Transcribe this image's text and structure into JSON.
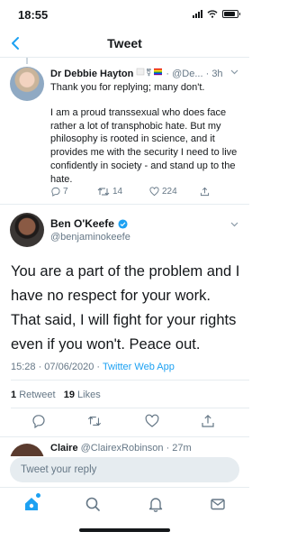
{
  "status": {
    "time": "18:55"
  },
  "nav": {
    "title": "Tweet"
  },
  "reply": {
    "name": "Dr Debbie Hayton",
    "handle_meta": "· @De... · 3h",
    "body": [
      "Thank you for replying; many don't.",
      "I am a proud transsexual who does face rather a lot of transphobic hate. But my philosophy is rooted in science, and it provides me with the security I need to live confidently in society - and stand up to the hate."
    ],
    "replies": "7",
    "retweets": "14",
    "likes": "224"
  },
  "tweet": {
    "name": "Ben O'Keefe",
    "handle": "@benjaminokeefe",
    "text": "You are a part of the problem and I have no respect for your work. That said, I will fight for your rights even if you won't. Peace out.",
    "timestamp": "15:28 · 07/06/2020 · ",
    "source": "Twitter Web App",
    "retweet_count": "1",
    "retweet_label": "Retweet",
    "like_count": "19",
    "like_label": "Likes"
  },
  "next_reply": {
    "name": "Claire",
    "handle_meta": "@ClairexRobinson · 27m"
  },
  "reply_box": {
    "placeholder": "Tweet your reply"
  },
  "colors": {
    "accent": "#1da1f2",
    "text": "#14171a",
    "muted": "#657786",
    "divider": "#e6ecf0"
  }
}
